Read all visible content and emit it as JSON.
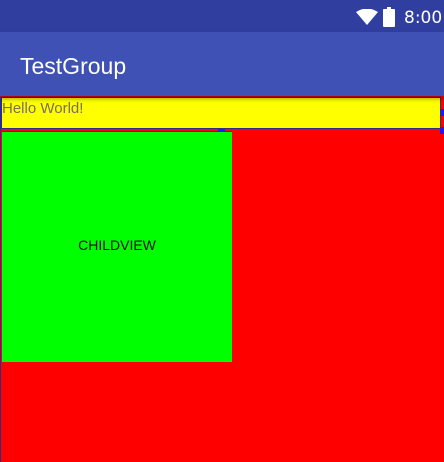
{
  "status_bar": {
    "time": "8:00",
    "wifi_icon": "wifi-icon",
    "battery_icon": "battery-icon",
    "background_color": "#303f9f"
  },
  "app_bar": {
    "title": "TestGroup",
    "background_color": "#3f51b5"
  },
  "hello_view": {
    "text": "Hello World!",
    "background_color": "#ffff00"
  },
  "child_view": {
    "label": "CHILDVIEW",
    "background_color": "#00ff00"
  },
  "parent_view": {
    "background_color": "#ff0000"
  }
}
